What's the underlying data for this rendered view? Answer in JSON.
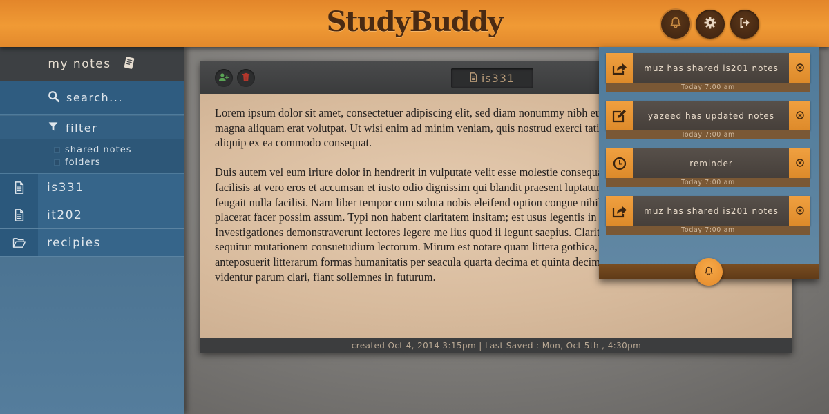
{
  "app": {
    "logo": "StudyBuddy"
  },
  "header": {
    "buttons": [
      {
        "name": "notifications",
        "icon": "bell-icon"
      },
      {
        "name": "settings",
        "icon": "gear-icon"
      },
      {
        "name": "logout",
        "icon": "logout-icon"
      }
    ]
  },
  "sidebar": {
    "title": "my notes",
    "title_icon": "notebook-icon",
    "search_placeholder": "search...",
    "filter_label": "filter",
    "filter_options": [
      "shared notes",
      "folders"
    ],
    "items": [
      {
        "label": "is331",
        "icon": "document-icon"
      },
      {
        "label": "it202",
        "icon": "document-icon"
      },
      {
        "label": "recipies",
        "icon": "folder-open-icon"
      }
    ]
  },
  "note": {
    "title": "is331",
    "paragraphs": [
      "Lorem ipsum dolor sit amet, consectetuer adipiscing elit, sed diam nonummy nibh euismod tincidunt ut laoreet dolore magna aliquam erat volutpat. Ut wisi enim ad minim veniam, quis nostrud exerci tation ullamcorper suscipit lobortis nisl ut aliquip ex ea commodo consequat.",
      " Duis autem vel eum iriure dolor in hendrerit in vulputate velit esse molestie consequat, vel illum dolore eu feugiat nulla facilisis at vero eros et accumsan et iusto odio dignissim qui blandit praesent luptatum zzril delenit augue duis dolore te feugait nulla facilisi. Nam liber tempor cum soluta nobis eleifend option congue nihil imperdiet doming id quod mazim placerat facer possim assum. Typi non habent claritatem insitam; est usus legentis in iis qui facit eorum claritatem. Investigationes demonstraverunt lectores legere me lius quod ii legunt saepius. Claritas est etiam processus dynamicus, qui sequitur mutationem consuetudium lectorum. Mirum est notare quam littera gothica, quam nunc putamus parum claram, anteposuerit litterarum formas humanitatis per seacula quarta decima et quinta decima. Eodem modo typi, qui nunc nobis videntur parum clari, fiant sollemnes in futurum."
    ],
    "footer": "created Oct 4, 2014 3:15pm | Last Saved : Mon, Oct 5th , 4:30pm"
  },
  "notifications": [
    {
      "icon": "share-icon",
      "text": "muz has shared is201 notes",
      "time": "Today 7:00 am"
    },
    {
      "icon": "edit-icon",
      "text": "yazeed has updated notes",
      "time": "Today 7:00 am"
    },
    {
      "icon": "clock-icon",
      "text": "reminder",
      "time": "Today 7:00 am"
    },
    {
      "icon": "share-icon",
      "text": "muz has shared is201 notes",
      "time": "Today 7:00 am"
    }
  ],
  "colors": {
    "accent_orange": "#f09a35",
    "sidebar_blue": "#36658a",
    "dark_brown": "#4a2a12",
    "note_paper": "#d8bb9d"
  }
}
